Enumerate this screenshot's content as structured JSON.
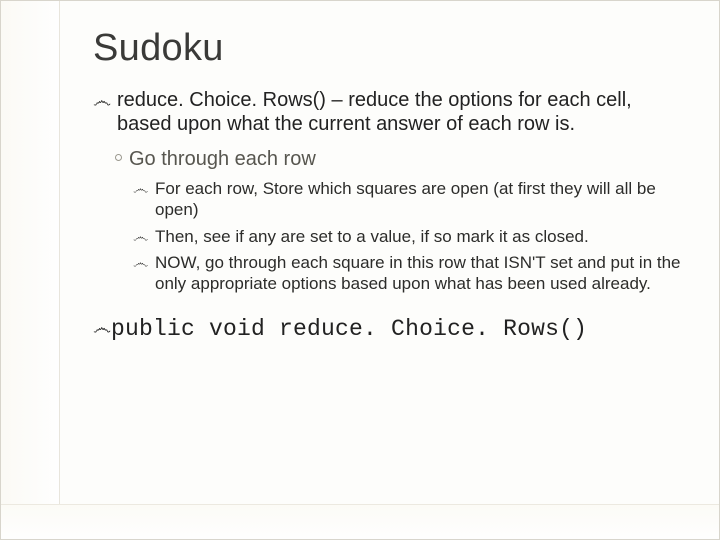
{
  "title": "Sudoku",
  "bullet_glyph": "෴",
  "main": {
    "lead_strong": "reduce. Choice. Rows()",
    "lead_rest": " – reduce the options for each cell, based upon what the current answer of each row is."
  },
  "sub": {
    "text": "Go through each row"
  },
  "items": [
    "For each row, Store which squares are open (at first they will all be open)",
    "Then, see if any are set to a value, if so mark it as closed.",
    "NOW, go through each square in this row that ISN'T set and put in the only appropriate options based upon what has been used already."
  ],
  "code": "public void reduce. Choice. Rows()"
}
